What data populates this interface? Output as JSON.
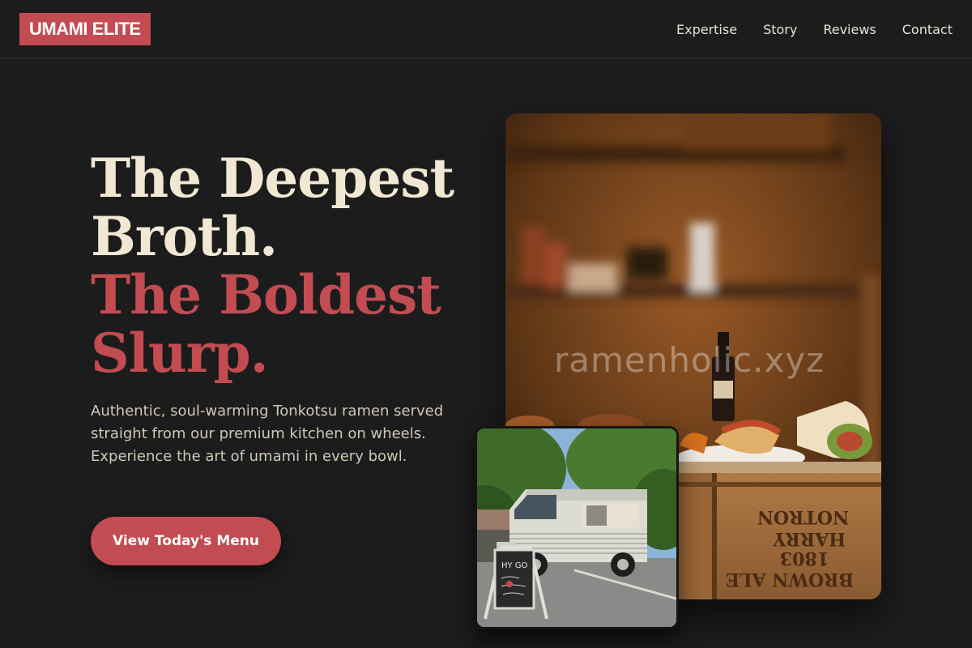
{
  "header": {
    "logo": "UMAMI ELITE",
    "nav": [
      {
        "label": "Expertise"
      },
      {
        "label": "Story"
      },
      {
        "label": "Reviews"
      },
      {
        "label": "Contact"
      }
    ]
  },
  "hero": {
    "title_line1": "The Deepest",
    "title_line2": "Broth.",
    "title_line3": "The Boldest",
    "title_line4": "Slurp.",
    "description": "Authentic, soul-warming Tonkotsu ramen served straight from our premium kitchen on wheels. Experience the art of umami in every bowl.",
    "cta_label": "View Today's Menu"
  },
  "images": {
    "main_photo_watermark": "ramenholic.xyz",
    "crate_text_1": "NOTRON",
    "crate_text_2": "HARRY",
    "crate_text_3": "1803",
    "crate_text_4": "BROWN ALE",
    "sign_text": "HY GO"
  },
  "colors": {
    "accent": "#c24c52",
    "cream": "#f1e8d4",
    "background": "#1c1c1c"
  }
}
